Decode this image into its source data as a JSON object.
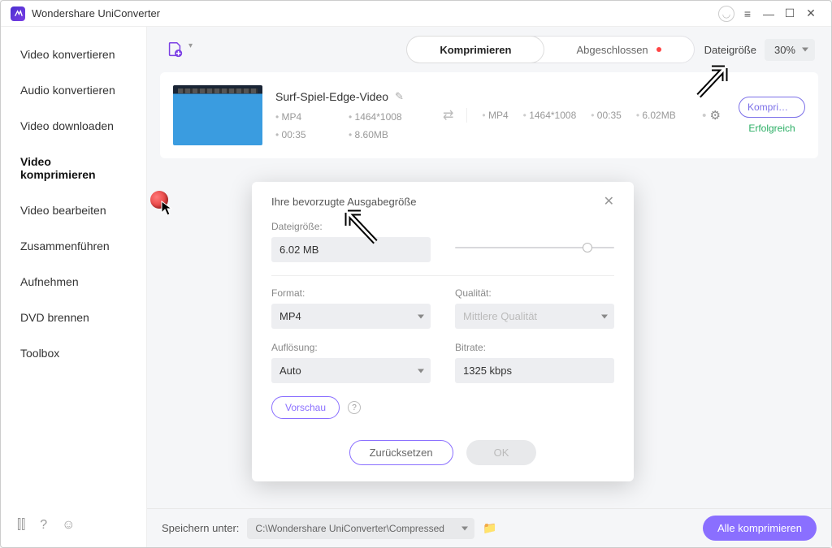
{
  "titlebar": {
    "title": "Wondershare UniConverter"
  },
  "sidebar": {
    "items": [
      {
        "label": "Video konvertieren"
      },
      {
        "label": "Audio konvertieren"
      },
      {
        "label": "Video downloaden"
      },
      {
        "label": "Video komprimieren"
      },
      {
        "label": "Video bearbeiten"
      },
      {
        "label": "Zusammenführen"
      },
      {
        "label": "Aufnehmen"
      },
      {
        "label": "DVD brennen"
      },
      {
        "label": "Toolbox"
      }
    ]
  },
  "toolbar": {
    "tabs": {
      "compress": "Komprimieren",
      "done": "Abgeschlossen"
    },
    "size_label": "Dateigröße",
    "size_value": "30%"
  },
  "item": {
    "title": "Surf-Spiel-Edge-Video",
    "in": {
      "format": "MP4",
      "resolution": "1464*1008",
      "duration": "00:35",
      "size": "8.60MB"
    },
    "out": {
      "format": "MP4",
      "resolution": "1464*1008",
      "duration": "00:35",
      "size": "6.02MB"
    },
    "action_label": "Komprimier...",
    "status": "Erfolgreich"
  },
  "dialog": {
    "title": "Ihre bevorzugte Ausgabegröße",
    "filesize_label": "Dateigröße:",
    "filesize_value": "6.02 MB",
    "format_label": "Format:",
    "format_value": "MP4",
    "quality_label": "Qualität:",
    "quality_placeholder": "Mittlere Qualität",
    "resolution_label": "Auflösung:",
    "resolution_value": "Auto",
    "bitrate_label": "Bitrate:",
    "bitrate_value": "1325 kbps",
    "preview": "Vorschau",
    "reset": "Zurücksetzen",
    "ok": "OK"
  },
  "footer": {
    "save_label": "Speichern unter:",
    "path": "C:\\Wondershare UniConverter\\Compressed",
    "all_compress": "Alle komprimieren"
  }
}
